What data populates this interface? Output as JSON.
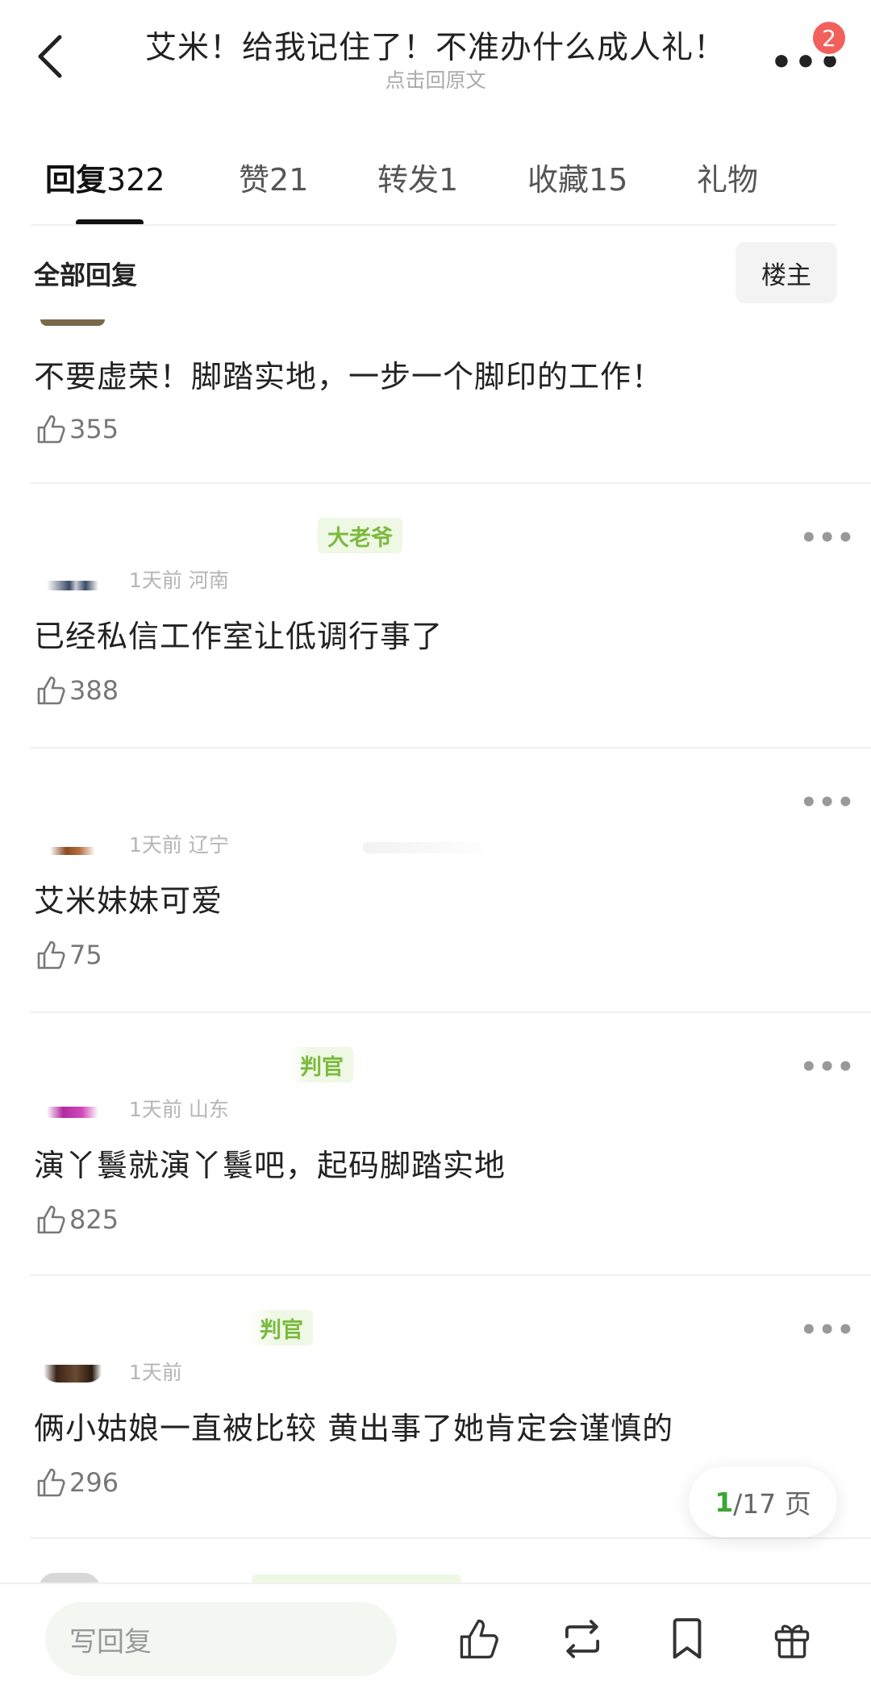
{
  "header": {
    "title": "艾米！给我记住了！不准办什么成人礼！",
    "subtitle": "点击回原文",
    "badge_count": "2"
  },
  "tabs": [
    {
      "label": "回复",
      "count": "322"
    },
    {
      "label": "赞",
      "count": "21"
    },
    {
      "label": "转发",
      "count": "1"
    },
    {
      "label": "收藏",
      "count": "15"
    },
    {
      "label": "礼物",
      "count": ""
    }
  ],
  "filter": {
    "label": "全部回复",
    "louzhu": "楼主"
  },
  "comments": [
    {
      "meta": "",
      "tag": "",
      "text": "不要虚荣！脚踏实地，一步一个脚印的工作！",
      "likes": "355"
    },
    {
      "meta": "1天前 河南",
      "tag": "大老爷",
      "text": "已经私信工作室让低调行事了",
      "likes": "388"
    },
    {
      "meta": "1天前 辽宁",
      "tag": "",
      "text": "艾米妹妹可爱",
      "likes": "75"
    },
    {
      "meta": "1天前 山东",
      "tag": "判官",
      "text": "演丫鬟就演丫鬟吧，起码脚踏实地",
      "likes": "825"
    },
    {
      "meta": "1天前",
      "tag": "判官",
      "text": "俩小姑娘一直被比较 黄出事了她肯定会谨慎的",
      "likes": "296"
    }
  ],
  "pagination": {
    "current": "1",
    "total": "/17 页"
  },
  "bottom_bar": {
    "reply_placeholder": "写回复"
  },
  "colors": {
    "accent_green": "#3aa735",
    "tag_green": "#7cba3e",
    "badge_red": "#f2605c"
  },
  "icons": [
    "back-arrow-icon",
    "more-icon",
    "thumbs-up-icon",
    "repost-icon",
    "bookmark-icon",
    "gift-icon"
  ]
}
